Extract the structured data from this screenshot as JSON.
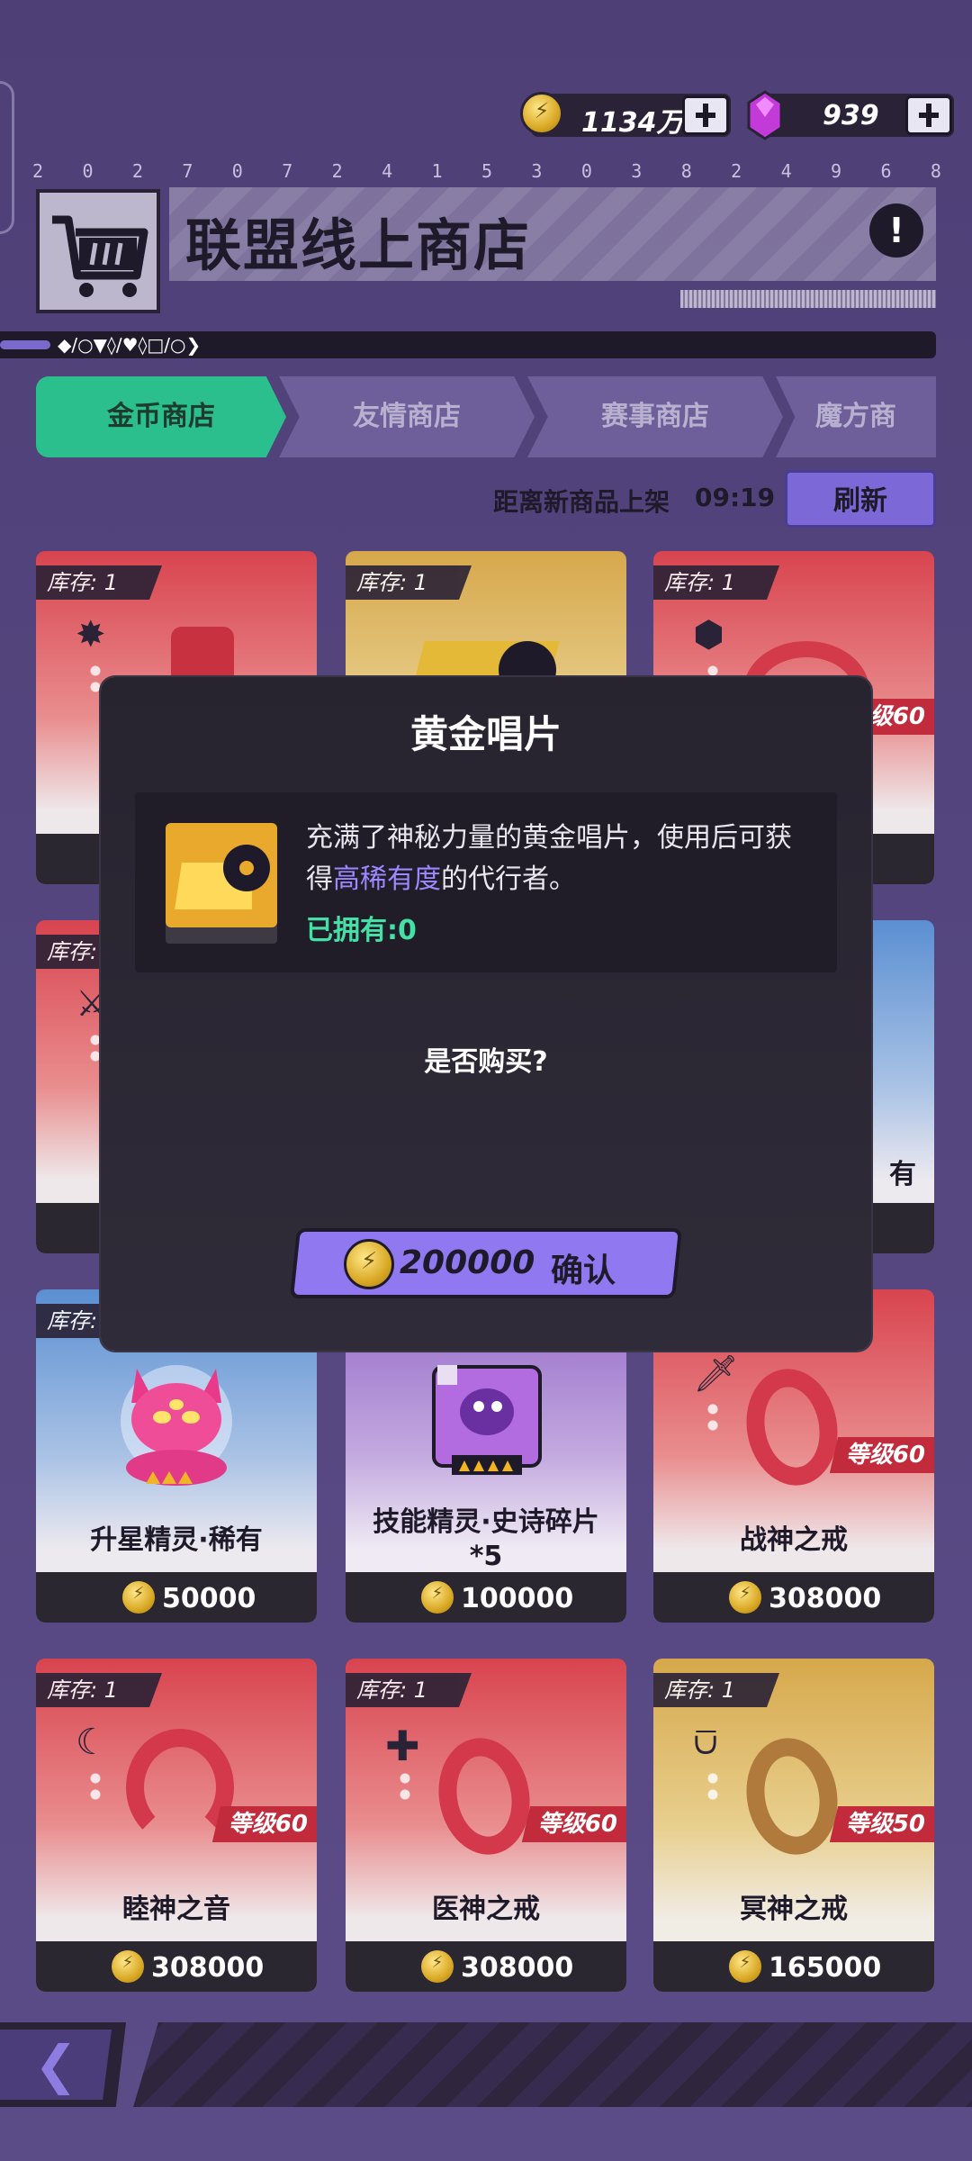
{
  "currency": {
    "coins": "1134万",
    "gems": "939"
  },
  "serial_digits": [
    "2",
    "0",
    "2",
    "7",
    "0",
    "7",
    "2",
    "4",
    "1",
    "5",
    "3",
    "0",
    "3",
    "8",
    "2",
    "4",
    "9",
    "6",
    "8"
  ],
  "header": {
    "title": "联盟线上商店",
    "symbol_strip": "◆/○▼◊/♥◊□/○❯"
  },
  "tabs": [
    {
      "label": "金币商店",
      "active": true
    },
    {
      "label": "友情商店",
      "active": false
    },
    {
      "label": "赛事商店",
      "active": false
    },
    {
      "label": "魔方商",
      "active": false
    }
  ],
  "refresh": {
    "label": "距离新商品上架",
    "time": "09:19",
    "button": "刷新"
  },
  "items": [
    {
      "stock": "库存: 1",
      "name": "",
      "price": "",
      "theme": "red"
    },
    {
      "stock": "库存: 1",
      "name": "",
      "price": "",
      "theme": "gold"
    },
    {
      "stock": "库存: 1",
      "name": "",
      "price": "",
      "level": "等级60",
      "theme": "red"
    },
    {
      "stock": "库存: 1",
      "name": "",
      "price": "",
      "theme": "red"
    },
    {
      "stock": "",
      "name": "",
      "price": "",
      "theme": "gold"
    },
    {
      "stock": "",
      "name": "有",
      "price": "",
      "theme": "blue"
    },
    {
      "stock": "库存:",
      "name": "升星精灵·稀有",
      "price": "50000",
      "theme": "blue"
    },
    {
      "stock": "",
      "name": "技能精灵·史诗碎片*5",
      "price": "100000",
      "theme": "purple"
    },
    {
      "stock": "",
      "name": "战神之戒",
      "price": "308000",
      "level": "等级60",
      "theme": "red"
    },
    {
      "stock": "库存: 1",
      "name": "睦神之音",
      "price": "308000",
      "level": "等级60",
      "theme": "red"
    },
    {
      "stock": "库存: 1",
      "name": "医神之戒",
      "price": "308000",
      "level": "等级60",
      "theme": "red"
    },
    {
      "stock": "库存: 1",
      "name": "冥神之戒",
      "price": "165000",
      "level": "等级50",
      "theme": "gold"
    }
  ],
  "dialog": {
    "title": "黄金唱片",
    "desc_part1": "充满了神秘力量的黄金唱片，使用后可获得",
    "desc_highlight": "高稀有度",
    "desc_part2": "的代行者。",
    "owned": "已拥有:0",
    "question": "是否购买?",
    "price": "200000",
    "confirm": "确认"
  },
  "colors": {
    "accent_green": "#2cbf8e",
    "accent_purple": "#8f78f0",
    "highlight": "#9d88ff",
    "owned": "#45e0a6"
  }
}
